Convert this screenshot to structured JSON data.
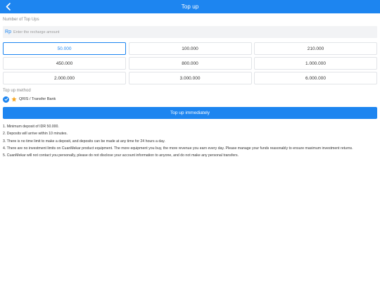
{
  "header": {
    "title": "Top up",
    "back_icon": "chevron-left-icon"
  },
  "amount": {
    "section_label": "Number of Top Ups",
    "currency": "Rp",
    "placeholder": "Enter the recharge amount",
    "value": ""
  },
  "options": {
    "selected": "50.000",
    "items": [
      "50.000",
      "100.000",
      "210.000",
      "450.000",
      "800.000",
      "1.000.000",
      "2.000.000",
      "3.000.000",
      "6.000.000"
    ]
  },
  "method": {
    "section_label": "Top up method",
    "check_icon": "check-circle-icon",
    "method_icon": "star-icon",
    "label": "QRIS / Transfer Bank",
    "selected": true
  },
  "button": {
    "label": "Top up immediately"
  },
  "notes": [
    "1. Minimum deposit of IDR 50.000.",
    "2. Deposits will arrive within 10 minutes.",
    "3. There is no time limit to make a deposit, and deposits can be made at any time for 24 hours a day.",
    "4. There are no investment limits on CuanMekar product equipment. The more equipment you buy, the more revenue you earn every day. Please manage your funds reasonably to ensure maximum investment returns.",
    "5. CuanMekar will not contact you personally, please do not disclose your account information to anyone, and do not make any personal transfers."
  ],
  "colors": {
    "accent": "#1d85f0",
    "input_bg": "#f2f3f5",
    "border": "#e2e4e8",
    "star": "#f5a623"
  }
}
